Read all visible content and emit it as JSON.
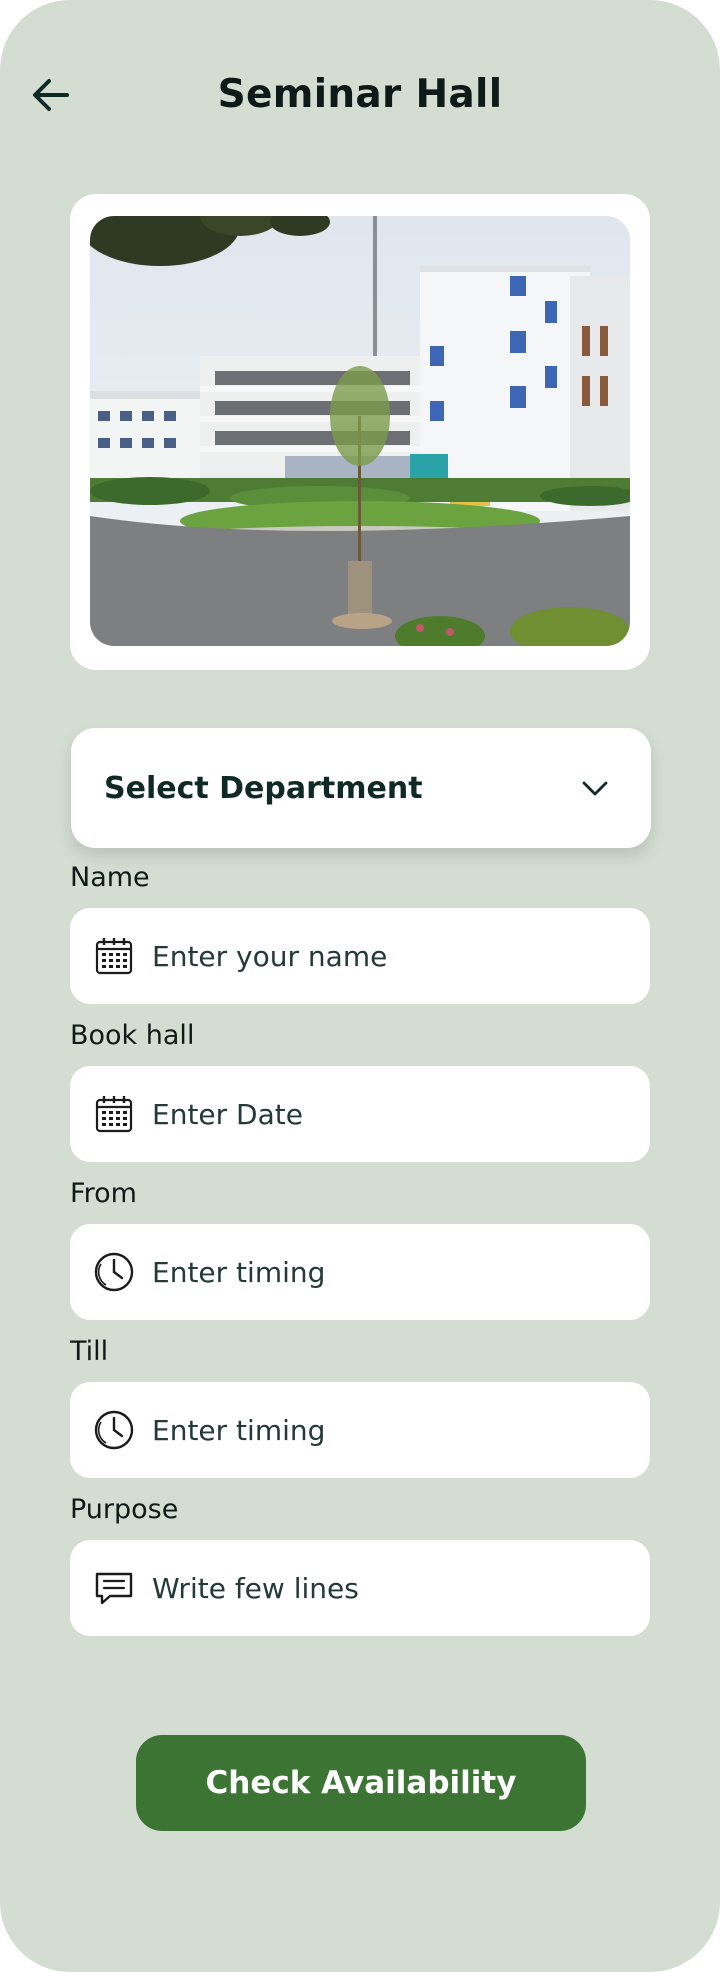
{
  "header": {
    "title": "Seminar Hall",
    "back_icon": "arrow-left-icon"
  },
  "photo": {
    "subject": "college building with lawn and road"
  },
  "department": {
    "label": "Select Department",
    "icon": "chevron-down-icon"
  },
  "form": {
    "name": {
      "label": "Name",
      "placeholder": "Enter your name",
      "icon": "calendar-icon"
    },
    "book_hall": {
      "label": "Book hall",
      "placeholder": "Enter Date",
      "icon": "calendar-icon"
    },
    "from": {
      "label": "From",
      "placeholder": "Enter timing",
      "icon": "clock-icon"
    },
    "till": {
      "label": "Till",
      "placeholder": "Enter timing",
      "icon": "clock-icon"
    },
    "purpose": {
      "label": "Purpose",
      "placeholder": "Write few lines",
      "icon": "message-icon"
    }
  },
  "actions": {
    "check_label": "Check Availability"
  },
  "colors": {
    "background": "#d3ddd1",
    "card": "#ffffff",
    "primary_button": "#3c7434",
    "text_dark": "#0e1a17"
  }
}
